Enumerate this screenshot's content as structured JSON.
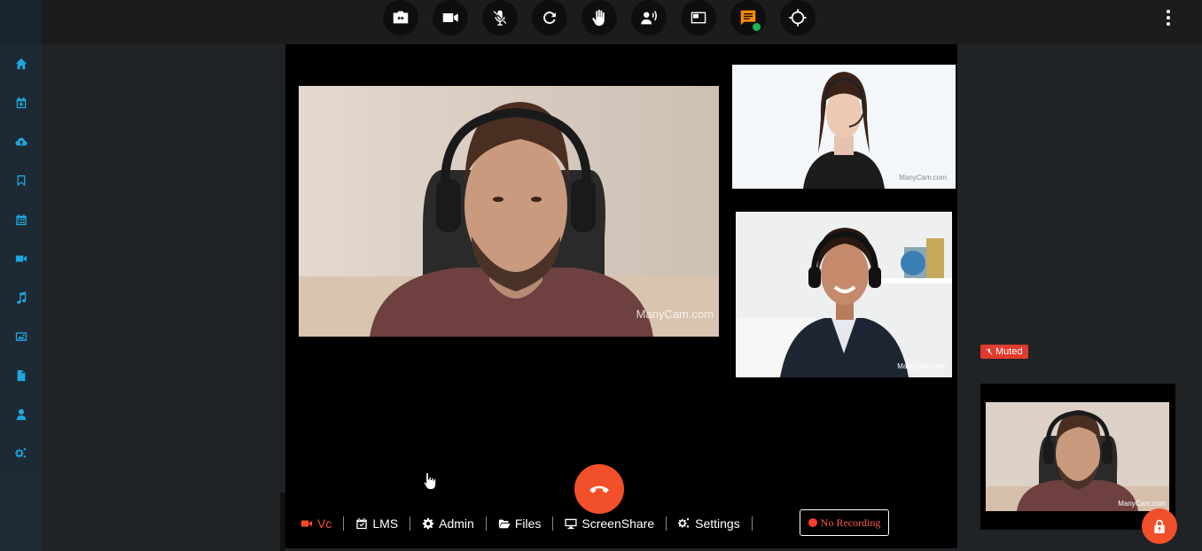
{
  "sidebar": {
    "items": [
      {
        "icon": "home-icon"
      },
      {
        "icon": "calendar-plus-icon"
      },
      {
        "icon": "cloud-upload-icon"
      },
      {
        "icon": "bookmark-icon"
      },
      {
        "icon": "calendar-icon"
      },
      {
        "icon": "video-camera-icon"
      },
      {
        "icon": "music-icon"
      },
      {
        "icon": "image-icon"
      },
      {
        "icon": "file-icon"
      },
      {
        "icon": "user-icon"
      },
      {
        "icon": "cogs-icon"
      }
    ],
    "icon_color": "#1da8e0"
  },
  "toolbar": {
    "buttons": [
      {
        "icon": "switch-camera-icon"
      },
      {
        "icon": "video-camera-icon"
      },
      {
        "icon": "microphone-muted-icon"
      },
      {
        "icon": "refresh-icon"
      },
      {
        "icon": "raise-hand-icon"
      },
      {
        "icon": "speaker-voice-icon"
      },
      {
        "icon": "layout-icon"
      },
      {
        "icon": "chat-icon",
        "color": "#ff8a00",
        "status_dot": "#1bb55c"
      },
      {
        "icon": "crosshair-icon"
      }
    ],
    "more_icon": "more-vertical-icon"
  },
  "videos": {
    "main": {
      "watermark": "ManyCam.com"
    },
    "participant_1": {
      "watermark": "ManyCam.com"
    },
    "participant_2": {
      "watermark": "ManyCam.com"
    }
  },
  "controls": {
    "tabs": [
      {
        "label": "Vc",
        "icon": "video-camera-icon",
        "active": true
      },
      {
        "label": "LMS",
        "icon": "calendar-check-icon"
      },
      {
        "label": "Admin",
        "icon": "gear-icon"
      },
      {
        "label": "Files",
        "icon": "folder-open-icon"
      },
      {
        "label": "ScreenShare",
        "icon": "monitor-icon"
      },
      {
        "label": "Settings",
        "icon": "cogs-icon"
      }
    ],
    "recording_label": "No Recording",
    "active_color": "#ff4a2a",
    "hangup_color": "#f2502a"
  },
  "self_view": {
    "muted_label": "Muted",
    "watermark": "ManyCam.com",
    "badge_color": "#e23a2e"
  }
}
